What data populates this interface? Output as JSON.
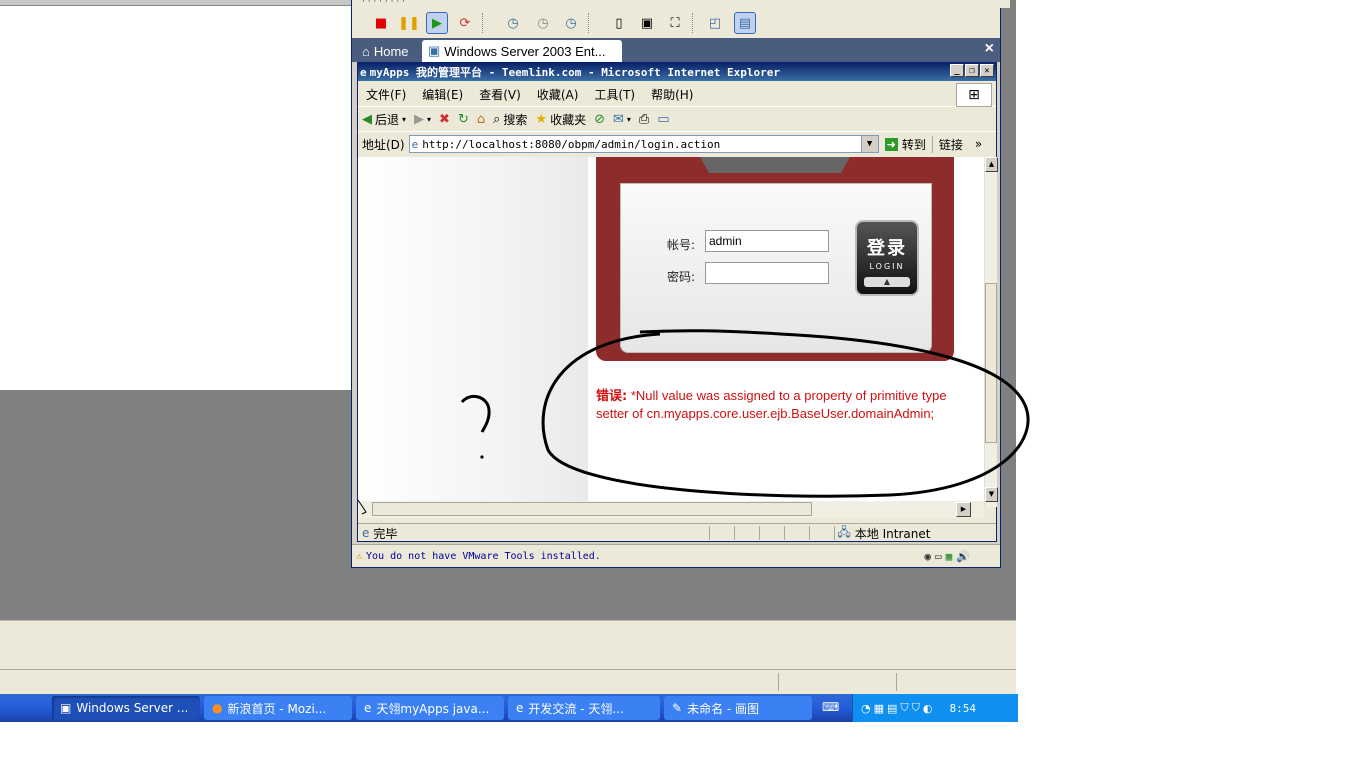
{
  "vmware": {
    "tabs": [
      {
        "label": "Home",
        "icon": "home-icon"
      },
      {
        "label": "Windows Server 2003 Ent...",
        "icon": "vm-icon"
      }
    ],
    "close_label": "×",
    "status_text": "You do not have VMware Tools installed."
  },
  "ie": {
    "title": "myApps 我的管理平台 - Teemlink.com - Microsoft Internet Explorer",
    "menu": [
      "文件(F)",
      "编辑(E)",
      "查看(V)",
      "收藏(A)",
      "工具(T)",
      "帮助(H)"
    ],
    "toolbar": {
      "back": "后退",
      "search": "搜索",
      "favorites": "收藏夹"
    },
    "address_label": "地址(D)",
    "address": "http://localhost:8080/obpm/admin/login.action",
    "go_label": "转到",
    "links_label": "链接",
    "status_left": "完毕",
    "status_zone": "本地 Intranet"
  },
  "login": {
    "account_label": "帐号:",
    "account_value": "admin",
    "password_label": "密码:",
    "button_cn": "登录",
    "button_en": "LOGIN",
    "error_prefix": "错误:",
    "error_text": "*Null value was assigned to a property of primitive type setter of cn.myapps.core.user.ejb.BaseUser.domainAdmin;"
  },
  "taskbar": {
    "tasks": [
      {
        "label": "Windows Server ...",
        "icon": "vmware-icon"
      },
      {
        "label": "新浪首页 - Mozi...",
        "icon": "firefox-icon"
      },
      {
        "label": "天翎myApps java...",
        "icon": "ie-icon"
      },
      {
        "label": "开发交流 - 天翎...",
        "icon": "ie-icon"
      },
      {
        "label": "未命名 - 画图",
        "icon": "paint-icon"
      }
    ],
    "clock": "8:54"
  }
}
